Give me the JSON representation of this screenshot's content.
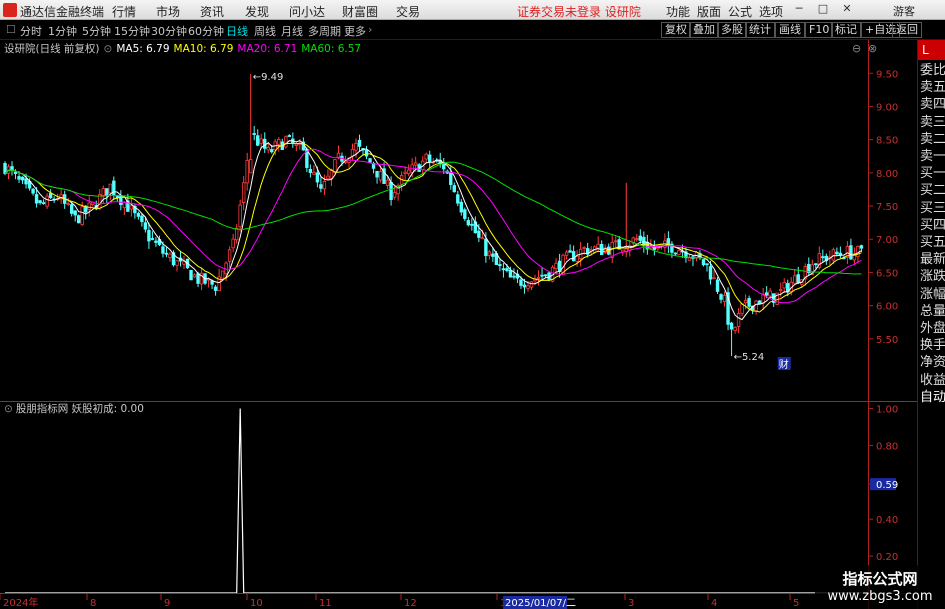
{
  "titlebar": {
    "app_name": "通达信金融终端",
    "menus": [
      "行情",
      "市场",
      "资讯",
      "发现",
      "问小达",
      "财富圈",
      "交易"
    ],
    "notice": "证券交易未登录 设研院",
    "right_menus": [
      "功能",
      "版面",
      "公式",
      "选项"
    ],
    "user": "游客"
  },
  "toolbar": {
    "periods": [
      "分时",
      "1分钟",
      "5分钟",
      "15分钟",
      "30分钟",
      "60分钟",
      "日线",
      "周线",
      "月线",
      "多周期",
      "更多"
    ],
    "active_period": "日线",
    "right_buttons": [
      "复权",
      "叠加",
      "多股",
      "统计",
      "画线",
      "F10",
      "标记",
      "+自选",
      "返回"
    ]
  },
  "right_panel": {
    "header": "L",
    "items": [
      "委比",
      "卖五",
      "卖四",
      "卖三",
      "卖二",
      "卖一",
      "买一",
      "买二",
      "买三",
      "买四",
      "买五",
      "最新",
      "涨跌",
      "涨幅",
      "总量",
      "外盘",
      "换手",
      "净资",
      "收益",
      "自动"
    ]
  },
  "colors": {
    "up": "#ff3c3c",
    "down": "#54ffff",
    "ma5": "#ffffff",
    "ma10": "#ffff00",
    "ma20": "#ff00ff",
    "ma60": "#00e000",
    "axis": "#b02020",
    "indicator": "#ffffff",
    "accent": "#d8261c"
  },
  "chart_data": [
    {
      "type": "candlestick",
      "title": "设研院(日线 前复权)",
      "legend": [
        {
          "name": "MA5",
          "value": "6.79",
          "color": "#ffffff"
        },
        {
          "name": "MA10",
          "value": "6.79",
          "color": "#ffff00"
        },
        {
          "name": "MA20",
          "value": "6.71",
          "color": "#ff00ff"
        },
        {
          "name": "MA60",
          "value": "6.57",
          "color": "#00e000"
        }
      ],
      "ylim": [
        5.0,
        9.7
      ],
      "y_ticks": [
        "9.50",
        "9.00",
        "8.50",
        "8.00",
        "7.50",
        "7.00",
        "6.50",
        "6.00",
        "5.50"
      ],
      "annotations": [
        {
          "label": "9.49",
          "x_index": 70,
          "value": 9.49
        },
        {
          "label": "5.24",
          "x_index": 207,
          "value": 5.24
        },
        {
          "label": "财",
          "x_index": 221
        }
      ],
      "keypoints": [
        [
          0,
          8.1
        ],
        [
          5,
          7.8
        ],
        [
          10,
          7.5
        ],
        [
          15,
          7.65
        ],
        [
          20,
          7.3
        ],
        [
          25,
          7.5
        ],
        [
          30,
          7.8
        ],
        [
          35,
          7.5
        ],
        [
          40,
          7.1
        ],
        [
          45,
          6.8
        ],
        [
          50,
          6.6
        ],
        [
          55,
          6.4
        ],
        [
          60,
          6.3
        ],
        [
          65,
          6.9
        ],
        [
          68,
          7.8
        ],
        [
          70,
          8.6
        ],
        [
          75,
          8.3
        ],
        [
          80,
          8.5
        ],
        [
          85,
          8.3
        ],
        [
          90,
          7.7
        ],
        [
          95,
          8.2
        ],
        [
          100,
          8.4
        ],
        [
          105,
          8.1
        ],
        [
          110,
          7.7
        ],
        [
          115,
          8.0
        ],
        [
          120,
          8.2
        ],
        [
          125,
          8.1
        ],
        [
          130,
          7.5
        ],
        [
          135,
          7.0
        ],
        [
          140,
          6.6
        ],
        [
          145,
          6.35
        ],
        [
          150,
          6.4
        ],
        [
          155,
          6.5
        ],
        [
          160,
          6.7
        ],
        [
          165,
          6.85
        ],
        [
          170,
          6.85
        ],
        [
          175,
          6.9
        ],
        [
          180,
          7.0
        ],
        [
          185,
          6.85
        ],
        [
          190,
          6.9
        ],
        [
          195,
          6.8
        ],
        [
          200,
          6.6
        ],
        [
          205,
          6.05
        ],
        [
          207,
          5.55
        ],
        [
          210,
          5.95
        ],
        [
          215,
          6.1
        ],
        [
          220,
          6.15
        ],
        [
          225,
          6.4
        ],
        [
          230,
          6.65
        ],
        [
          235,
          6.75
        ],
        [
          240,
          6.8
        ],
        [
          244,
          6.79
        ]
      ]
    },
    {
      "type": "line",
      "title": "股朋指标网 妖股初成: 0.00",
      "ylim": [
        0,
        1.1
      ],
      "y_ticks": [
        "1.00",
        "0.80",
        "0.59",
        "0.40",
        "0.20"
      ],
      "current_value": "0.59",
      "series": [
        {
          "name": "妖股初成",
          "spike_index": 67,
          "spike_value": 1.0,
          "baseline": 0
        }
      ]
    }
  ],
  "x_axis": {
    "labels": [
      "2024年",
      "8",
      "9",
      "10",
      "11",
      "12",
      "1",
      "2025/01/07/二",
      "3",
      "4",
      "5"
    ],
    "highlight": "2025/01/07/二"
  },
  "watermark": {
    "line1": "指标公式网",
    "line2": "www.zbgs3.com"
  }
}
